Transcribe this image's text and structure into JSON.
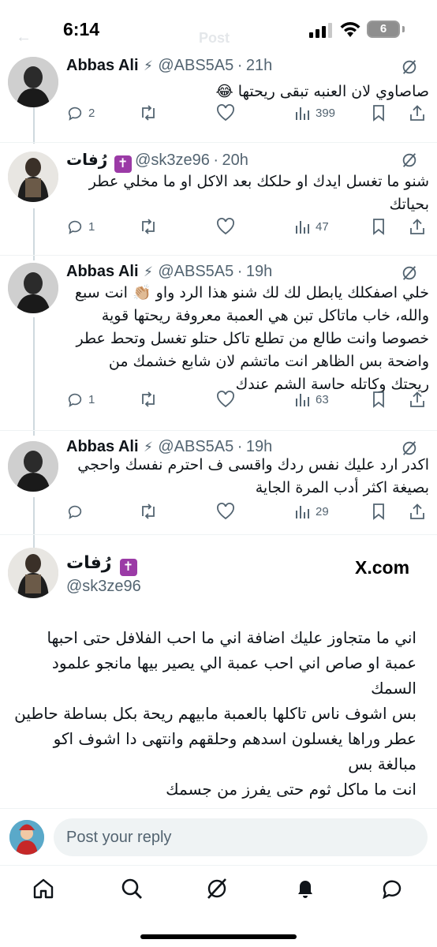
{
  "status_bar": {
    "time": "6:14",
    "battery": "6",
    "ghost_back": "←",
    "ghost_title": "Post"
  },
  "tweets": [
    {
      "name": "Abbas Ali",
      "handle": "@ABS5A5",
      "time": "21h",
      "text": "صاصاوي لان العنبه تبقى ريحتها 😂",
      "replies": "2",
      "views": "399"
    },
    {
      "name": "رُفات",
      "handle": "@sk3ze96",
      "time": "20h",
      "text": "شنو ما تغسل ايدك او حلكك بعد الاكل او ما مخلي عطر بحياتك",
      "replies": "1",
      "views": "47"
    },
    {
      "name": "Abbas Ali",
      "handle": "@ABS5A5",
      "time": "19h",
      "text": "خلي اصفكلك يابطل لك لك شنو هذا الرد واو 👏🏼 انت سبع والله، خاب ماتاكل تبن هي العمبة معروفة ريحتها قوية خصوصا وانت طالع من تطلع تاكل حتلو تغسل وتحط عطر واضحة بس الظاهر انت ماتشم لان شابع خشمك من ريحتك وكاتله حاسة الشم عندك",
      "replies": "1",
      "views": "63"
    },
    {
      "name": "Abbas Ali",
      "handle": "@ABS5A5",
      "time": "19h",
      "text": "اكدر ارد عليك نفس ردك واقسى ف احترم نفسك واحجي بصيغة اكثر أدب المرة الجاية",
      "replies": "",
      "views": "29"
    }
  ],
  "main_tweet": {
    "name": "رُفات",
    "handle": "@sk3ze96",
    "watermark": "X.com",
    "text": "اني ما متجاوز عليك اضافة اني ما احب الفلافل حتى احبها عمبة او صاص اني احب عمبة الي يصير بيها مانجو علمود السمك\nبس اشوف ناس تاكلها بالعمبة مابيهم ريحة بكل بساطة حاطين عطر وراها يغسلون اسدهم وحلقهم وانتهى دا اشوف اكو مبالغة بس\nانت ما ماكل ثوم حتى يفرز من جسمك"
  },
  "reply_bar": {
    "placeholder": "Post your reply"
  },
  "tabs": [
    "home",
    "search",
    "grok",
    "notifications",
    "messages"
  ],
  "colors": {
    "text": "#0f1419",
    "muted": "#536471",
    "divider": "#eff3f4",
    "thread": "#cfd9de"
  }
}
